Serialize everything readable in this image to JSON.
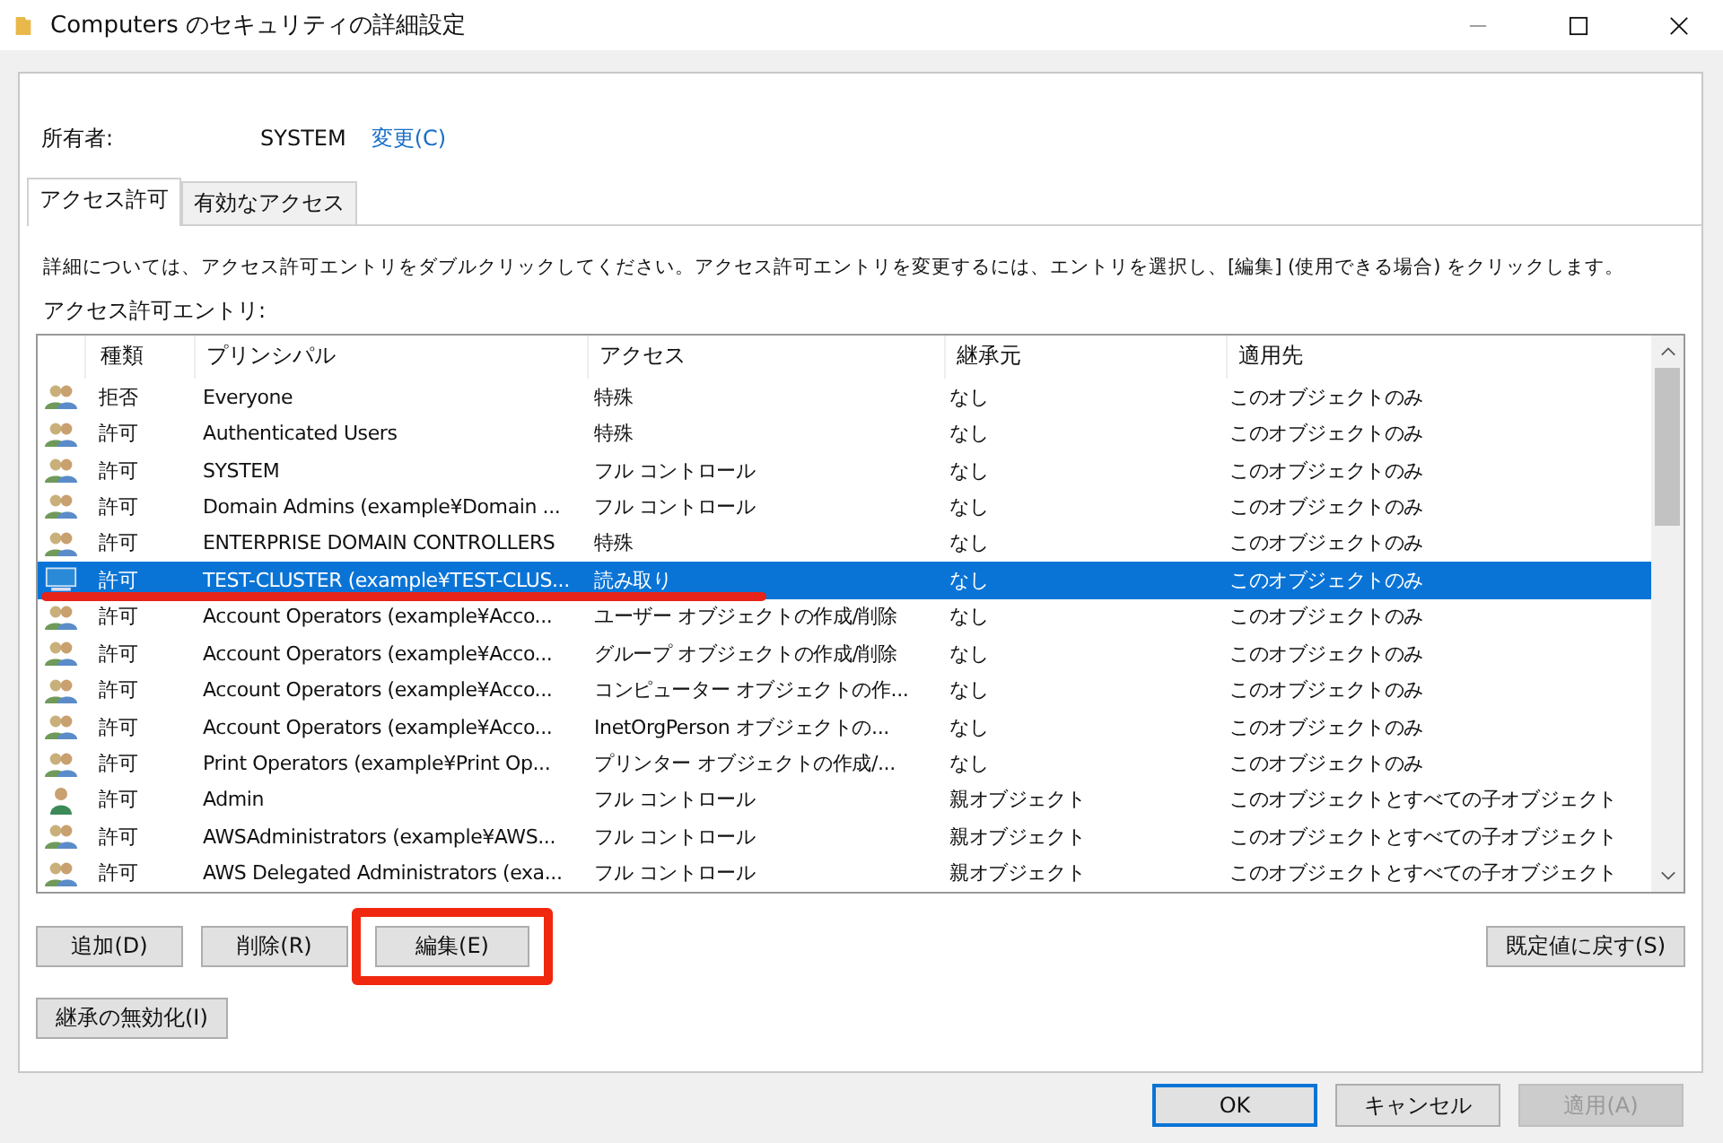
{
  "window": {
    "title": "Computers のセキュリティの詳細設定"
  },
  "owner": {
    "label": "所有者:",
    "value": "SYSTEM",
    "link": "変更(C)"
  },
  "tabs": [
    {
      "label": "アクセス許可",
      "selected": true
    },
    {
      "label": "有効なアクセス",
      "selected": false
    }
  ],
  "description": "詳細については、アクセス許可エントリをダブルクリックしてください。アクセス許可エントリを変更するには、エントリを選択し、[編集] (使用できる場合) をクリックします。",
  "list_label": "アクセス許可エントリ:",
  "table": {
    "columns": [
      "種類",
      "プリンシパル",
      "アクセス",
      "継承元",
      "適用先"
    ],
    "rows": [
      {
        "kind": "group",
        "selected": false,
        "underlined": false,
        "cells": [
          "拒否",
          "Everyone",
          "特殊",
          "なし",
          "このオブジェクトのみ"
        ]
      },
      {
        "kind": "group",
        "selected": false,
        "underlined": false,
        "cells": [
          "許可",
          "Authenticated Users",
          "特殊",
          "なし",
          "このオブジェクトのみ"
        ]
      },
      {
        "kind": "group",
        "selected": false,
        "underlined": false,
        "cells": [
          "許可",
          "SYSTEM",
          "フル コントロール",
          "なし",
          "このオブジェクトのみ"
        ]
      },
      {
        "kind": "group",
        "selected": false,
        "underlined": false,
        "cells": [
          "許可",
          "Domain Admins (example¥Domain ...",
          "フル コントロール",
          "なし",
          "このオブジェクトのみ"
        ]
      },
      {
        "kind": "group",
        "selected": false,
        "underlined": false,
        "cells": [
          "許可",
          "ENTERPRISE DOMAIN CONTROLLERS",
          "特殊",
          "なし",
          "このオブジェクトのみ"
        ]
      },
      {
        "kind": "computer",
        "selected": true,
        "underlined": true,
        "cells": [
          "許可",
          "TEST-CLUSTER (example¥TEST-CLUS...",
          "読み取り",
          "なし",
          "このオブジェクトのみ"
        ]
      },
      {
        "kind": "group",
        "selected": false,
        "underlined": false,
        "cells": [
          "許可",
          "Account Operators (example¥Acco...",
          "ユーザー オブジェクトの作成/削除",
          "なし",
          "このオブジェクトのみ"
        ]
      },
      {
        "kind": "group",
        "selected": false,
        "underlined": false,
        "cells": [
          "許可",
          "Account Operators (example¥Acco...",
          "グループ オブジェクトの作成/削除",
          "なし",
          "このオブジェクトのみ"
        ]
      },
      {
        "kind": "group",
        "selected": false,
        "underlined": false,
        "cells": [
          "許可",
          "Account Operators (example¥Acco...",
          "コンピューター オブジェクトの作...",
          "なし",
          "このオブジェクトのみ"
        ]
      },
      {
        "kind": "group",
        "selected": false,
        "underlined": false,
        "cells": [
          "許可",
          "Account Operators (example¥Acco...",
          "InetOrgPerson オブジェクトの...",
          "なし",
          "このオブジェクトのみ"
        ]
      },
      {
        "kind": "group",
        "selected": false,
        "underlined": false,
        "cells": [
          "許可",
          "Print Operators (example¥Print Op...",
          "プリンター オブジェクトの作成/...",
          "なし",
          "このオブジェクトのみ"
        ]
      },
      {
        "kind": "user",
        "selected": false,
        "underlined": false,
        "cells": [
          "許可",
          "Admin",
          "フル コントロール",
          "親オブジェクト",
          "このオブジェクトとすべての子オブジェクト"
        ]
      },
      {
        "kind": "group",
        "selected": false,
        "underlined": false,
        "cells": [
          "許可",
          "AWSAdministrators (example¥AWS...",
          "フル コントロール",
          "親オブジェクト",
          "このオブジェクトとすべての子オブジェクト"
        ]
      },
      {
        "kind": "group",
        "selected": false,
        "underlined": false,
        "cells": [
          "許可",
          "AWS Delegated Administrators (exa...",
          "フル コントロール",
          "親オブジェクト",
          "このオブジェクトとすべての子オブジェクト"
        ]
      }
    ]
  },
  "entry_buttons": [
    {
      "label": "追加(D)",
      "highlighted": false
    },
    {
      "label": "削除(R)",
      "highlighted": false
    },
    {
      "label": "編集(E)",
      "highlighted": true
    }
  ],
  "restore_button": "既定値に戻す(S)",
  "inheritance_button": "継承の無効化(I)",
  "dialog_buttons": [
    {
      "label": "OK",
      "default": true,
      "disabled": false
    },
    {
      "label": "キャンセル",
      "default": false,
      "disabled": false
    },
    {
      "label": "適用(A)",
      "default": false,
      "disabled": true
    }
  ]
}
